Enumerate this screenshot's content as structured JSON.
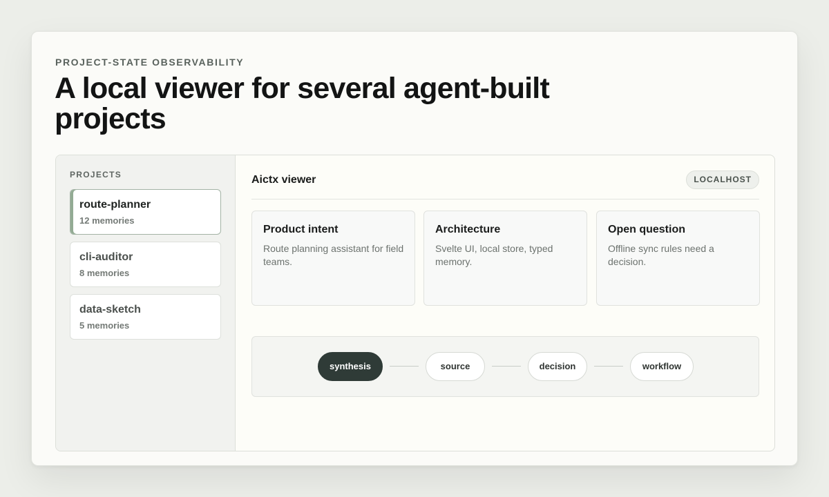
{
  "header": {
    "eyebrow": "PROJECT-STATE OBSERVABILITY",
    "title": "A local viewer for several agent-built projects"
  },
  "sidebar": {
    "heading": "PROJECTS",
    "projects": [
      {
        "name": "route-planner",
        "count": "12 memories",
        "active": true
      },
      {
        "name": "cli-auditor",
        "count": "8 memories",
        "active": false
      },
      {
        "name": "data-sketch",
        "count": "5 memories",
        "active": false
      }
    ]
  },
  "viewer": {
    "title": "Aictx viewer",
    "badge": "LOCALHOST",
    "cards": [
      {
        "title": "Product intent",
        "body": "Route planning assistant for field teams."
      },
      {
        "title": "Architecture",
        "body": "Svelte UI, local store, typed memory."
      },
      {
        "title": "Open question",
        "body": "Offline sync rules need a decision."
      }
    ],
    "flow": {
      "nodes": [
        "synthesis",
        "source",
        "decision",
        "workflow"
      ],
      "selected": "synthesis"
    }
  },
  "colors": {
    "accent": "#93ab94",
    "selected_node": "#2f3b37",
    "card_background": "#fbfbf8"
  }
}
